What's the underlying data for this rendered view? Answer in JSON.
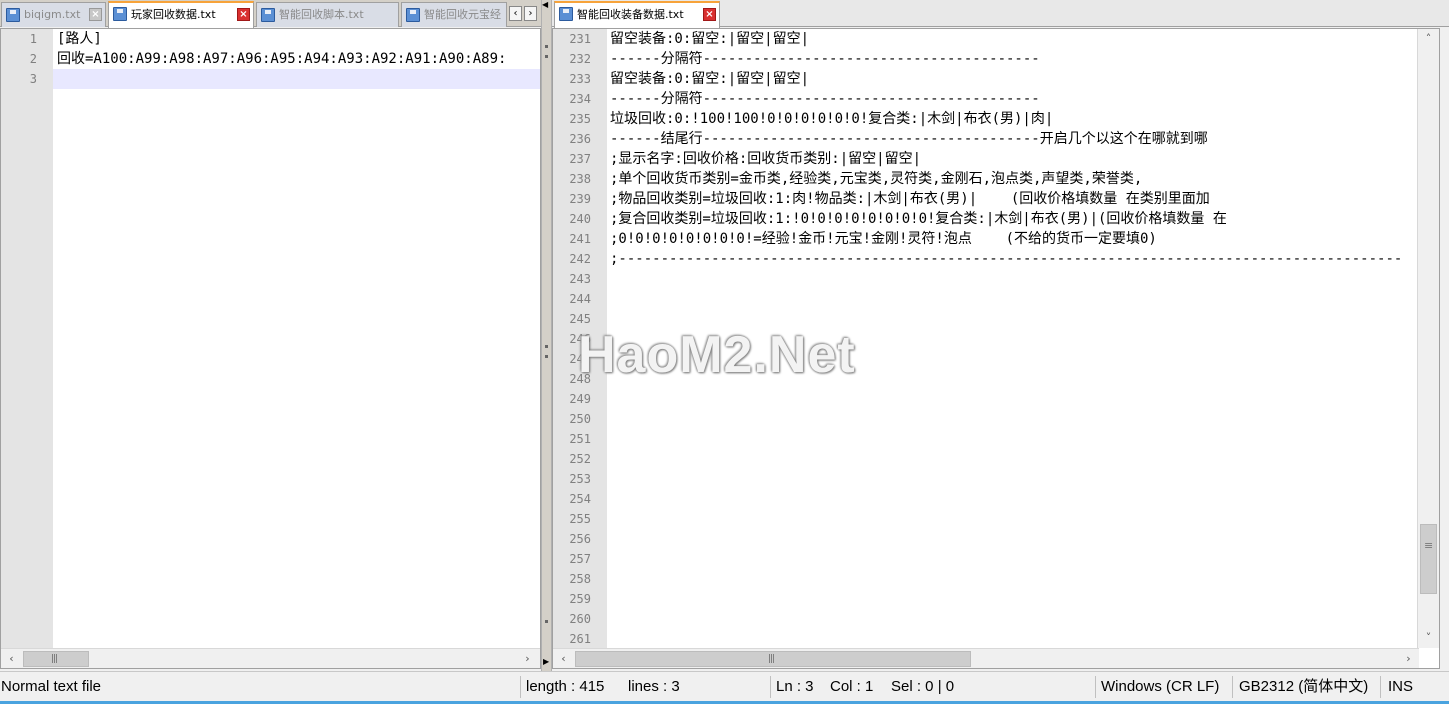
{
  "left_tabs": [
    {
      "label": "biqigm.txt",
      "active": false
    },
    {
      "label": "玩家回收数据.txt",
      "active": true
    },
    {
      "label": "智能回收脚本.txt",
      "active": false
    },
    {
      "label": "智能回收元宝经",
      "active": false
    }
  ],
  "right_tabs": [
    {
      "label": "智能回收装备数据.txt",
      "active": true
    }
  ],
  "left_editor": {
    "lines": [
      {
        "num": "1",
        "text": "[路人]"
      },
      {
        "num": "2",
        "text": "回收=A100:A99:A98:A97:A96:A95:A94:A93:A92:A91:A90:A89:"
      },
      {
        "num": "3",
        "text": ""
      }
    ],
    "current_line": 3
  },
  "right_editor": {
    "lines": [
      {
        "num": "231",
        "text": "留空装备:0:留空:|留空|留空|"
      },
      {
        "num": "232",
        "text": "------分隔符----------------------------------------"
      },
      {
        "num": "233",
        "text": "留空装备:0:留空:|留空|留空|"
      },
      {
        "num": "234",
        "text": "------分隔符----------------------------------------"
      },
      {
        "num": "235",
        "text": "垃圾回收:0:!100!100!0!0!0!0!0!0!复合类:|木剑|布衣(男)|肉|"
      },
      {
        "num": "236",
        "text": "------结尾行----------------------------------------开启几个以这个在哪就到哪"
      },
      {
        "num": "237",
        "text": ";显示名字:回收价格:回收货币类别:|留空|留空|"
      },
      {
        "num": "238",
        "text": ";单个回收货币类别=金币类,经验类,元宝类,灵符类,金刚石,泡点类,声望类,荣誉类,"
      },
      {
        "num": "239",
        "text": ";物品回收类别=垃圾回收:1:肉!物品类:|木剑|布衣(男)|    (回收价格填数量 在类别里面加"
      },
      {
        "num": "240",
        "text": ";复合回收类别=垃圾回收:1:!0!0!0!0!0!0!0!0!复合类:|木剑|布衣(男)|(回收价格填数量 在"
      },
      {
        "num": "241",
        "text": ";0!0!0!0!0!0!0!0!=经验!金币!元宝!金刚!灵符!泡点    (不给的货币一定要填0)"
      },
      {
        "num": "242",
        "text": ";---------------------------------------------------------------------------------------------"
      },
      {
        "num": "243",
        "text": ""
      },
      {
        "num": "244",
        "text": ""
      },
      {
        "num": "245",
        "text": ""
      },
      {
        "num": "246",
        "text": ""
      },
      {
        "num": "247",
        "text": ""
      },
      {
        "num": "248",
        "text": ""
      },
      {
        "num": "249",
        "text": ""
      },
      {
        "num": "250",
        "text": ""
      },
      {
        "num": "251",
        "text": ""
      },
      {
        "num": "252",
        "text": ""
      },
      {
        "num": "253",
        "text": ""
      },
      {
        "num": "254",
        "text": ""
      },
      {
        "num": "255",
        "text": ""
      },
      {
        "num": "256",
        "text": ""
      },
      {
        "num": "257",
        "text": ""
      },
      {
        "num": "258",
        "text": ""
      },
      {
        "num": "259",
        "text": ""
      },
      {
        "num": "260",
        "text": ""
      },
      {
        "num": "261",
        "text": ""
      }
    ]
  },
  "watermark": "HaoM2.Net",
  "status": {
    "file_type": "Normal text file",
    "length": "length : 415",
    "lines": "lines : 3",
    "ln": "Ln : 3",
    "col": "Col : 1",
    "sel": "Sel : 0 | 0",
    "eol": "Windows (CR LF)",
    "encoding": "GB2312 (简体中文)",
    "mode": "INS"
  },
  "colors": {
    "active_tab_accent": "#f7a33a",
    "close_active": "#d93030",
    "current_line": "#e8e8ff",
    "gutter": "#e4e4e4",
    "status_accent": "#4aa3df"
  }
}
